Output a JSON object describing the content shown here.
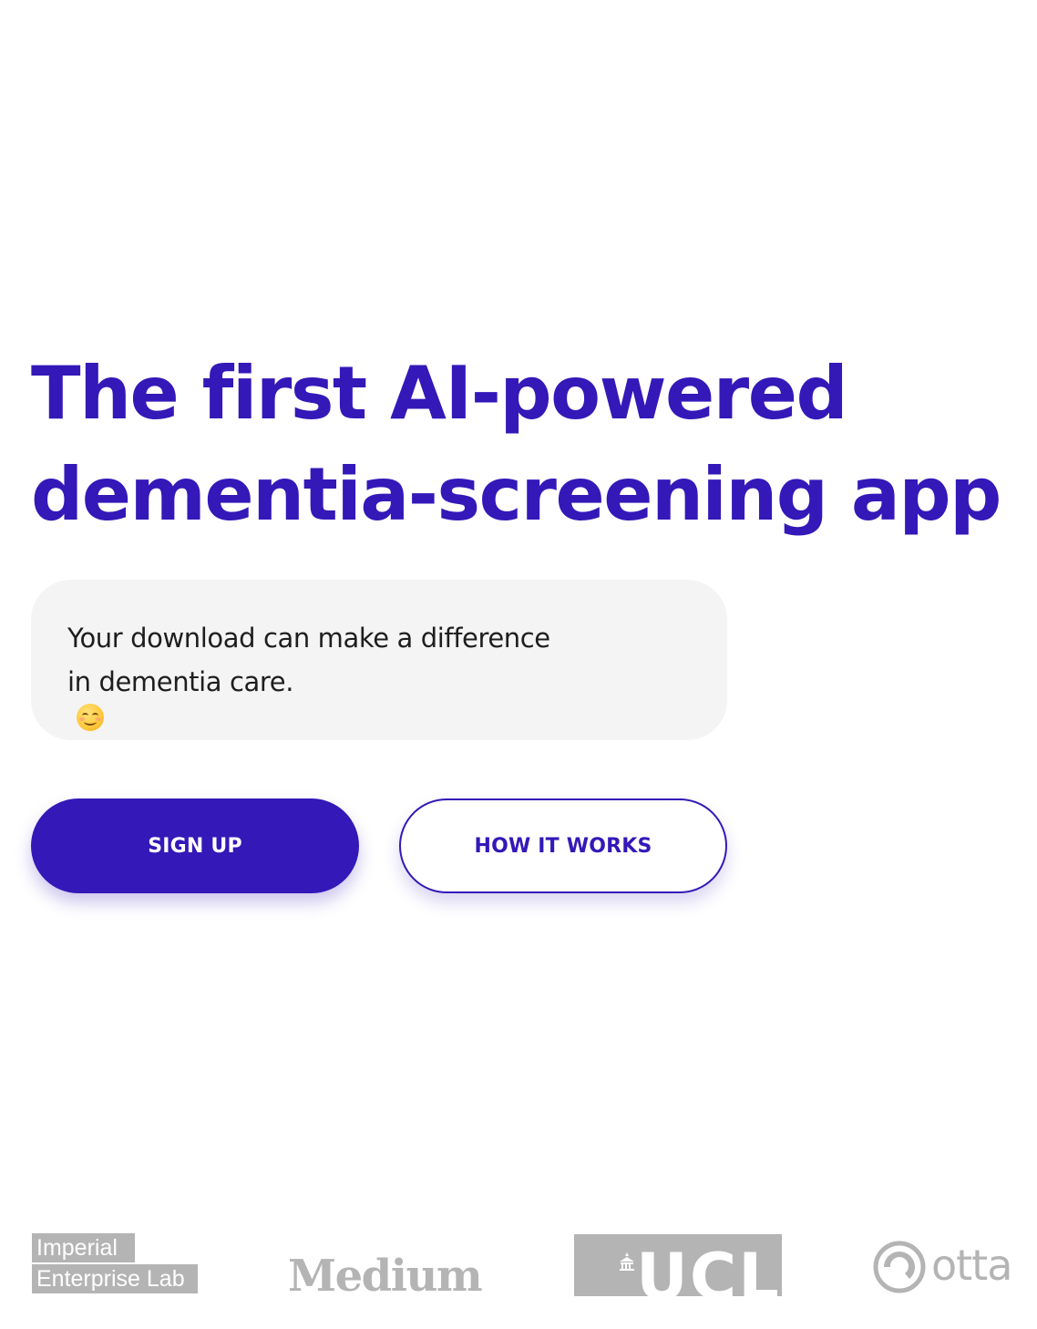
{
  "hero": {
    "title_line1": "The first AI-powered",
    "title_line2": "dementia-screening app",
    "accent_color": "#3418b8"
  },
  "subtitle": {
    "line1": "Your download can make a difference",
    "line2": "in dementia care.",
    "emoji_icon": "smiling-face-icon",
    "background_color": "#f4f4f4"
  },
  "buttons": {
    "signup_label": "SIGN UP",
    "how_it_works_label": "HOW IT WORKS"
  },
  "logos": {
    "imperial_line1": "Imperial",
    "imperial_line2": "Enterprise Lab",
    "medium": "Medium",
    "ucl": "UCL",
    "otta": "otta",
    "logo_color": "#b4b4b4"
  }
}
